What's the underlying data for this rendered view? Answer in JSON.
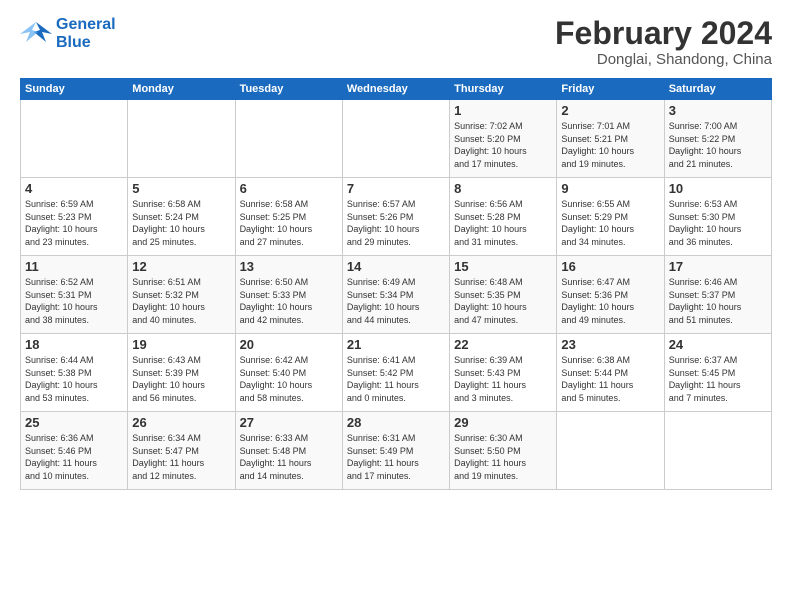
{
  "logo": {
    "line1": "General",
    "line2": "Blue"
  },
  "title": "February 2024",
  "subtitle": "Donglai, Shandong, China",
  "days_header": [
    "Sunday",
    "Monday",
    "Tuesday",
    "Wednesday",
    "Thursday",
    "Friday",
    "Saturday"
  ],
  "weeks": [
    [
      {
        "day": "",
        "info": ""
      },
      {
        "day": "",
        "info": ""
      },
      {
        "day": "",
        "info": ""
      },
      {
        "day": "",
        "info": ""
      },
      {
        "day": "1",
        "info": "Sunrise: 7:02 AM\nSunset: 5:20 PM\nDaylight: 10 hours\nand 17 minutes."
      },
      {
        "day": "2",
        "info": "Sunrise: 7:01 AM\nSunset: 5:21 PM\nDaylight: 10 hours\nand 19 minutes."
      },
      {
        "day": "3",
        "info": "Sunrise: 7:00 AM\nSunset: 5:22 PM\nDaylight: 10 hours\nand 21 minutes."
      }
    ],
    [
      {
        "day": "4",
        "info": "Sunrise: 6:59 AM\nSunset: 5:23 PM\nDaylight: 10 hours\nand 23 minutes."
      },
      {
        "day": "5",
        "info": "Sunrise: 6:58 AM\nSunset: 5:24 PM\nDaylight: 10 hours\nand 25 minutes."
      },
      {
        "day": "6",
        "info": "Sunrise: 6:58 AM\nSunset: 5:25 PM\nDaylight: 10 hours\nand 27 minutes."
      },
      {
        "day": "7",
        "info": "Sunrise: 6:57 AM\nSunset: 5:26 PM\nDaylight: 10 hours\nand 29 minutes."
      },
      {
        "day": "8",
        "info": "Sunrise: 6:56 AM\nSunset: 5:28 PM\nDaylight: 10 hours\nand 31 minutes."
      },
      {
        "day": "9",
        "info": "Sunrise: 6:55 AM\nSunset: 5:29 PM\nDaylight: 10 hours\nand 34 minutes."
      },
      {
        "day": "10",
        "info": "Sunrise: 6:53 AM\nSunset: 5:30 PM\nDaylight: 10 hours\nand 36 minutes."
      }
    ],
    [
      {
        "day": "11",
        "info": "Sunrise: 6:52 AM\nSunset: 5:31 PM\nDaylight: 10 hours\nand 38 minutes."
      },
      {
        "day": "12",
        "info": "Sunrise: 6:51 AM\nSunset: 5:32 PM\nDaylight: 10 hours\nand 40 minutes."
      },
      {
        "day": "13",
        "info": "Sunrise: 6:50 AM\nSunset: 5:33 PM\nDaylight: 10 hours\nand 42 minutes."
      },
      {
        "day": "14",
        "info": "Sunrise: 6:49 AM\nSunset: 5:34 PM\nDaylight: 10 hours\nand 44 minutes."
      },
      {
        "day": "15",
        "info": "Sunrise: 6:48 AM\nSunset: 5:35 PM\nDaylight: 10 hours\nand 47 minutes."
      },
      {
        "day": "16",
        "info": "Sunrise: 6:47 AM\nSunset: 5:36 PM\nDaylight: 10 hours\nand 49 minutes."
      },
      {
        "day": "17",
        "info": "Sunrise: 6:46 AM\nSunset: 5:37 PM\nDaylight: 10 hours\nand 51 minutes."
      }
    ],
    [
      {
        "day": "18",
        "info": "Sunrise: 6:44 AM\nSunset: 5:38 PM\nDaylight: 10 hours\nand 53 minutes."
      },
      {
        "day": "19",
        "info": "Sunrise: 6:43 AM\nSunset: 5:39 PM\nDaylight: 10 hours\nand 56 minutes."
      },
      {
        "day": "20",
        "info": "Sunrise: 6:42 AM\nSunset: 5:40 PM\nDaylight: 10 hours\nand 58 minutes."
      },
      {
        "day": "21",
        "info": "Sunrise: 6:41 AM\nSunset: 5:42 PM\nDaylight: 11 hours\nand 0 minutes."
      },
      {
        "day": "22",
        "info": "Sunrise: 6:39 AM\nSunset: 5:43 PM\nDaylight: 11 hours\nand 3 minutes."
      },
      {
        "day": "23",
        "info": "Sunrise: 6:38 AM\nSunset: 5:44 PM\nDaylight: 11 hours\nand 5 minutes."
      },
      {
        "day": "24",
        "info": "Sunrise: 6:37 AM\nSunset: 5:45 PM\nDaylight: 11 hours\nand 7 minutes."
      }
    ],
    [
      {
        "day": "25",
        "info": "Sunrise: 6:36 AM\nSunset: 5:46 PM\nDaylight: 11 hours\nand 10 minutes."
      },
      {
        "day": "26",
        "info": "Sunrise: 6:34 AM\nSunset: 5:47 PM\nDaylight: 11 hours\nand 12 minutes."
      },
      {
        "day": "27",
        "info": "Sunrise: 6:33 AM\nSunset: 5:48 PM\nDaylight: 11 hours\nand 14 minutes."
      },
      {
        "day": "28",
        "info": "Sunrise: 6:31 AM\nSunset: 5:49 PM\nDaylight: 11 hours\nand 17 minutes."
      },
      {
        "day": "29",
        "info": "Sunrise: 6:30 AM\nSunset: 5:50 PM\nDaylight: 11 hours\nand 19 minutes."
      },
      {
        "day": "",
        "info": ""
      },
      {
        "day": "",
        "info": ""
      }
    ]
  ]
}
